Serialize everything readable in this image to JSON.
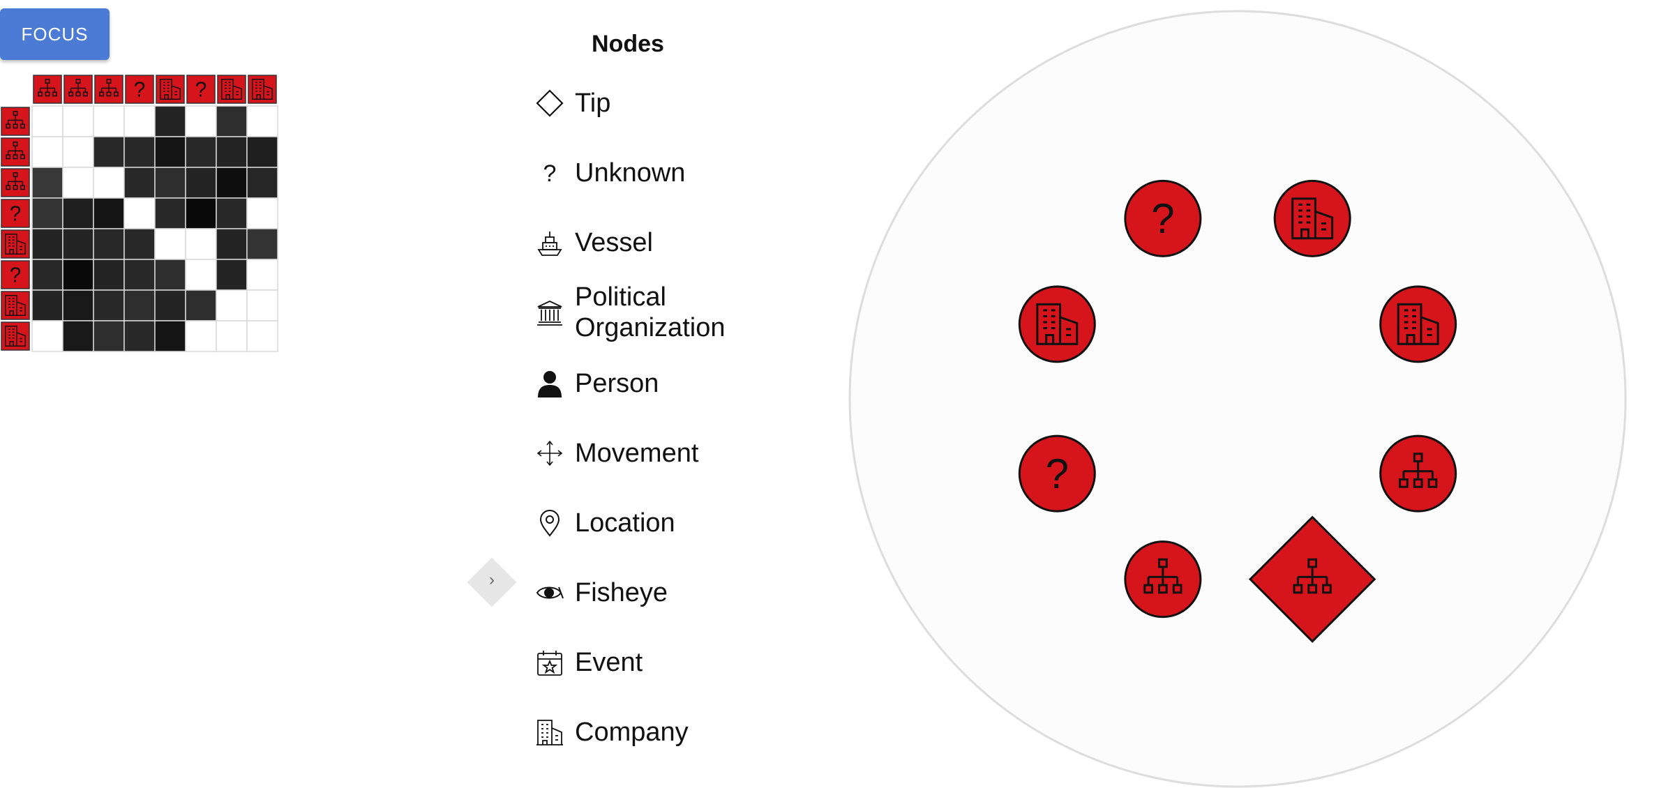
{
  "toolbar": {
    "focus_label": "FOCUS"
  },
  "matrix": {
    "row_types": [
      "org",
      "org",
      "org",
      "unknown",
      "company",
      "unknown",
      "company",
      "company"
    ],
    "col_types": [
      "org",
      "org",
      "org",
      "unknown",
      "company",
      "unknown",
      "company",
      "company"
    ],
    "cells": [
      [
        0.0,
        0.0,
        0.0,
        0.0,
        0.86,
        0.0,
        0.82,
        0.0
      ],
      [
        0.0,
        0.0,
        0.84,
        0.84,
        0.92,
        0.84,
        0.86,
        0.88
      ],
      [
        0.78,
        0.0,
        0.0,
        0.84,
        0.82,
        0.86,
        0.94,
        0.85
      ],
      [
        0.8,
        0.88,
        0.92,
        0.0,
        0.84,
        0.96,
        0.84,
        0.0
      ],
      [
        0.86,
        0.86,
        0.84,
        0.84,
        0.0,
        0.0,
        0.86,
        0.8
      ],
      [
        0.84,
        0.96,
        0.86,
        0.84,
        0.82,
        0.0,
        0.86,
        0.0
      ],
      [
        0.86,
        0.9,
        0.84,
        0.82,
        0.86,
        0.82,
        0.0,
        0.0
      ],
      [
        0.0,
        0.9,
        0.82,
        0.84,
        0.92,
        0.0,
        0.0,
        0.0
      ]
    ],
    "colors": {
      "node_fill": "#d6141c",
      "cell_dark": "#111111",
      "cell_empty": "#ffffff"
    }
  },
  "legend": {
    "title": "Nodes",
    "items": [
      {
        "label": "Tip",
        "icon": "diamond-icon"
      },
      {
        "label": "Unknown",
        "icon": "question-icon"
      },
      {
        "label": "Vessel",
        "icon": "ship-icon"
      },
      {
        "label": "Political Organization",
        "icon": "government-building-icon"
      },
      {
        "label": "Person",
        "icon": "person-icon"
      },
      {
        "label": "Movement",
        "icon": "move-arrows-icon"
      },
      {
        "label": "Location",
        "icon": "map-pin-icon"
      },
      {
        "label": "Fisheye",
        "icon": "eye-icon"
      },
      {
        "label": "Event",
        "icon": "calendar-star-icon"
      },
      {
        "label": "Company",
        "icon": "office-building-icon"
      }
    ]
  },
  "graph": {
    "nodes": [
      {
        "type": "company",
        "shape": "circle"
      },
      {
        "type": "company",
        "shape": "circle"
      },
      {
        "type": "org",
        "shape": "circle"
      },
      {
        "type": "org",
        "shape": "diamond"
      },
      {
        "type": "org",
        "shape": "circle"
      },
      {
        "type": "unknown",
        "shape": "circle"
      },
      {
        "type": "company",
        "shape": "circle"
      },
      {
        "type": "unknown",
        "shape": "circle"
      }
    ],
    "colors": {
      "node_fill": "#d6141c",
      "circle_bg": "#fcfcfc",
      "circle_border": "#dddddd"
    }
  }
}
